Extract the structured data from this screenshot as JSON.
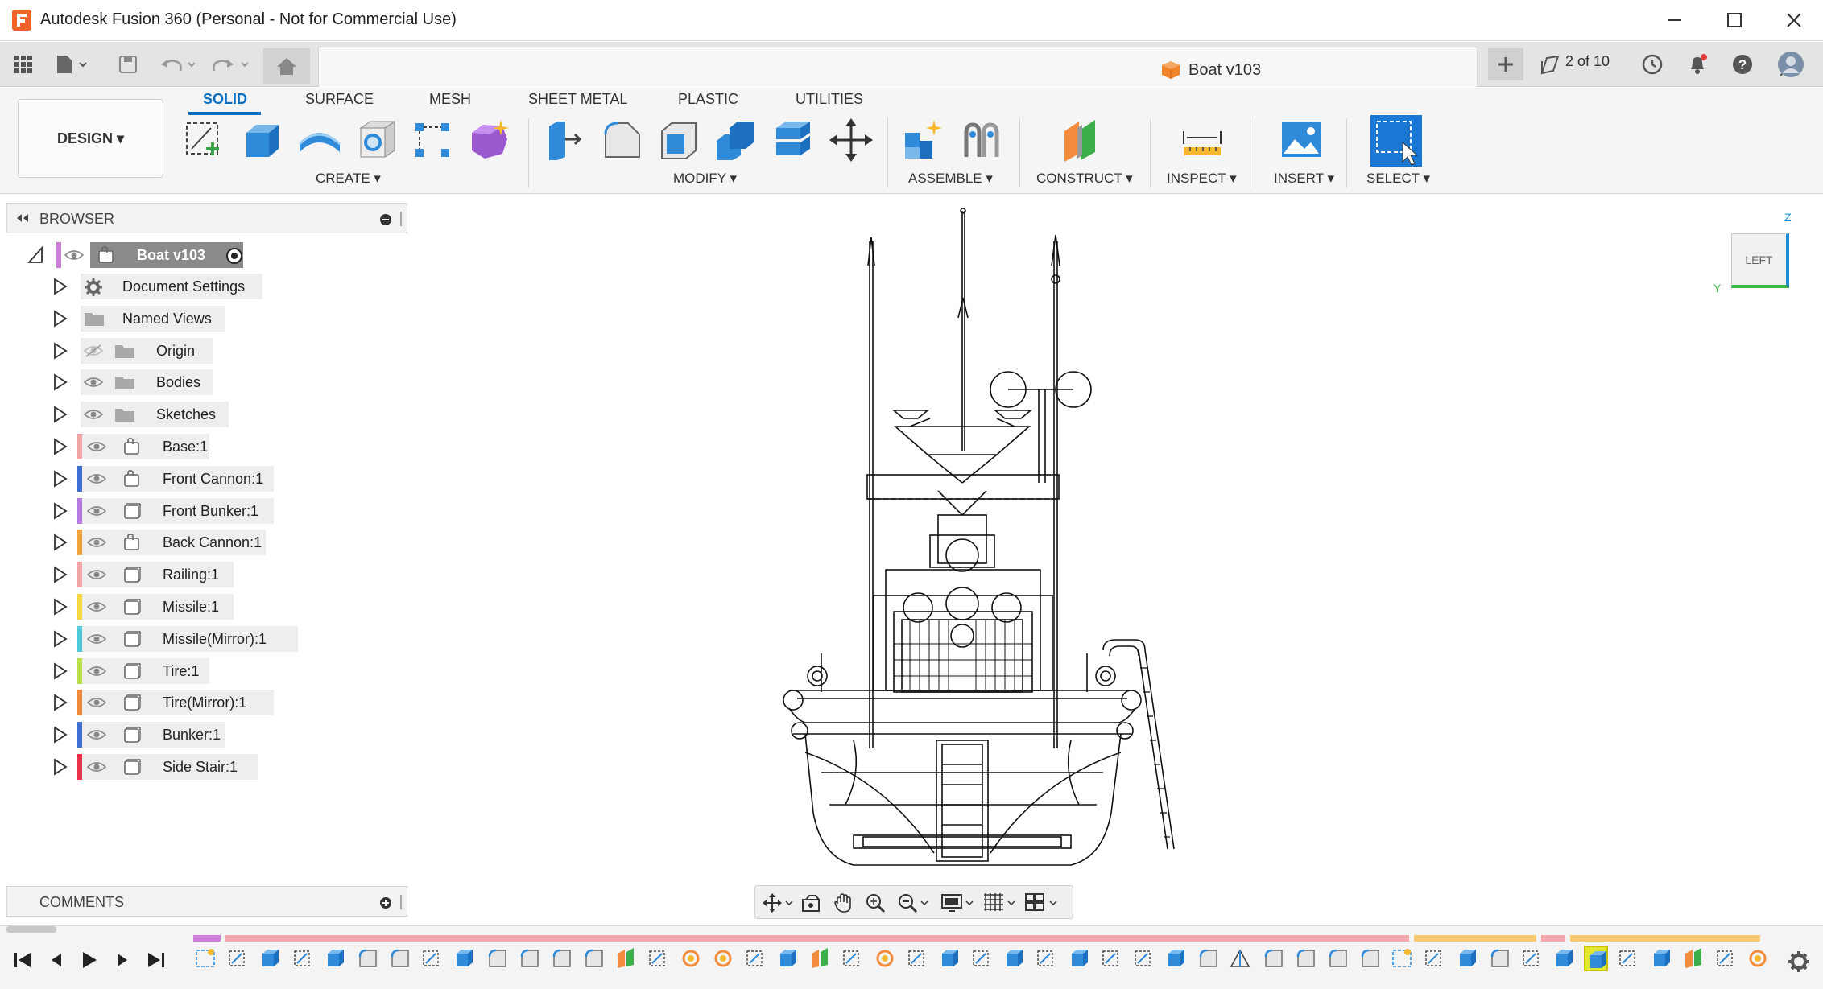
{
  "window": {
    "title": "Autodesk Fusion 360 (Personal - Not for Commercial Use)",
    "icons": [
      "fusion-logo-icon",
      "minimize-icon",
      "maximize-icon",
      "close-icon"
    ]
  },
  "quick_access": {
    "icons": [
      "grid-apps-icon",
      "file-menu-icon",
      "save-icon",
      "undo-icon",
      "redo-icon",
      "home-icon",
      "new-tab-icon",
      "job-status-icon",
      "notification-bell-icon",
      "help-icon",
      "user-avatar-icon"
    ],
    "document_tab": "Boat v103",
    "version_count": "2 of 10"
  },
  "ribbon": {
    "workspace": "DESIGN ▾",
    "tabs": [
      "SOLID",
      "SURFACE",
      "MESH",
      "SHEET METAL",
      "PLASTIC",
      "UTILITIES"
    ],
    "active_tab": "SOLID",
    "groups": {
      "create": "CREATE ▾",
      "modify": "MODIFY ▾",
      "assemble": "ASSEMBLE ▾",
      "construct": "CONSTRUCT ▾",
      "inspect": "INSPECT ▾",
      "insert": "INSERT ▾",
      "select": "SELECT ▾"
    }
  },
  "browser": {
    "title": "BROWSER",
    "root": "Boat v103",
    "items": [
      {
        "label": "Document Settings",
        "type": "settings",
        "color": ""
      },
      {
        "label": "Named Views",
        "type": "folder",
        "color": ""
      },
      {
        "label": "Origin",
        "type": "folder-hidden",
        "color": ""
      },
      {
        "label": "Bodies",
        "type": "folder",
        "color": ""
      },
      {
        "label": "Sketches",
        "type": "folder",
        "color": ""
      },
      {
        "label": "Base:1",
        "type": "component-linked",
        "color": "#f2a3a8"
      },
      {
        "label": "Front Cannon:1",
        "type": "component-linked",
        "color": "#3b6fd6"
      },
      {
        "label": "Front Bunker:1",
        "type": "component",
        "color": "#b57be0"
      },
      {
        "label": "Back Cannon:1",
        "type": "component-linked",
        "color": "#f2a43c"
      },
      {
        "label": "Railing:1",
        "type": "component",
        "color": "#f2a3a8"
      },
      {
        "label": "Missile:1",
        "type": "component",
        "color": "#f5d63c"
      },
      {
        "label": "Missile(Mirror):1",
        "type": "component",
        "color": "#4fc9d9"
      },
      {
        "label": "Tire:1",
        "type": "component",
        "color": "#b9e04a"
      },
      {
        "label": "Tire(Mirror):1",
        "type": "component",
        "color": "#f08a3c"
      },
      {
        "label": "Bunker:1",
        "type": "component",
        "color": "#3b6fd6"
      },
      {
        "label": "Side Stair:1",
        "type": "component",
        "color": "#e8334a"
      }
    ]
  },
  "viewcube": {
    "face": "LEFT",
    "axis_z": "Z",
    "axis_y": "Y"
  },
  "comments": {
    "title": "COMMENTS"
  },
  "nav_toolbar": {
    "icons": [
      "orbit-icon",
      "look-at-icon",
      "pan-icon",
      "zoom-window-icon",
      "zoom-icon",
      "display-settings-icon",
      "grid-icon",
      "viewports-icon"
    ]
  },
  "timeline": {
    "controls": [
      "go-to-start-icon",
      "step-back-icon",
      "play-icon",
      "step-forward-icon",
      "go-to-end-icon"
    ],
    "settings_icon": "gear-icon",
    "feature_count": 49
  }
}
